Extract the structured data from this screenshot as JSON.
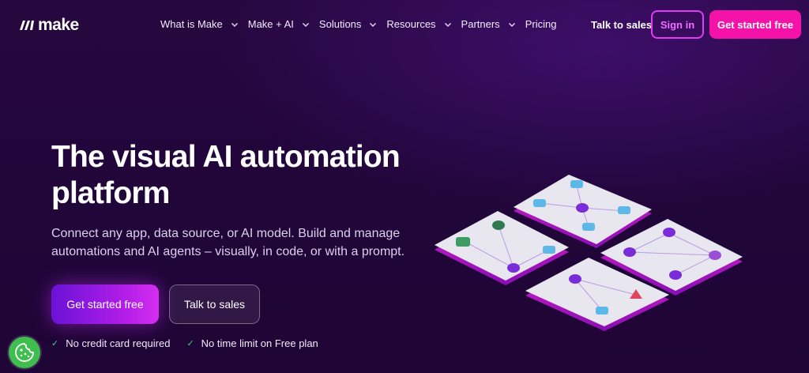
{
  "brand": {
    "name": "make"
  },
  "nav": {
    "items": [
      {
        "label": "What is Make",
        "has_dropdown": true
      },
      {
        "label": "Make + AI",
        "has_dropdown": true
      },
      {
        "label": "Solutions",
        "has_dropdown": true
      },
      {
        "label": "Resources",
        "has_dropdown": true
      },
      {
        "label": "Partners",
        "has_dropdown": true
      },
      {
        "label": "Pricing",
        "has_dropdown": false
      }
    ],
    "talk_to_sales": "Talk to sales",
    "sign_in": "Sign in",
    "get_started": "Get started free"
  },
  "hero": {
    "title": "The visual AI automation platform",
    "subtitle": "Connect any app, data source, or AI model. Build and manage automations and AI agents – visually, in code, or with a prompt.",
    "primary_cta": "Get started free",
    "secondary_cta": "Talk to sales",
    "checks": [
      "No credit card required",
      "No time limit on Free plan"
    ]
  },
  "icons": {
    "cookie": "cookie-icon",
    "check": "check-icon",
    "chevron": "chevron-down-icon"
  },
  "colors": {
    "background": "#22063b",
    "accent_pink": "#f512a8",
    "accent_magenta": "#e03cf5",
    "accent_purple": "#6a12d6",
    "check_green": "#3ad28a",
    "cookie_green": "#3fbe4f"
  }
}
